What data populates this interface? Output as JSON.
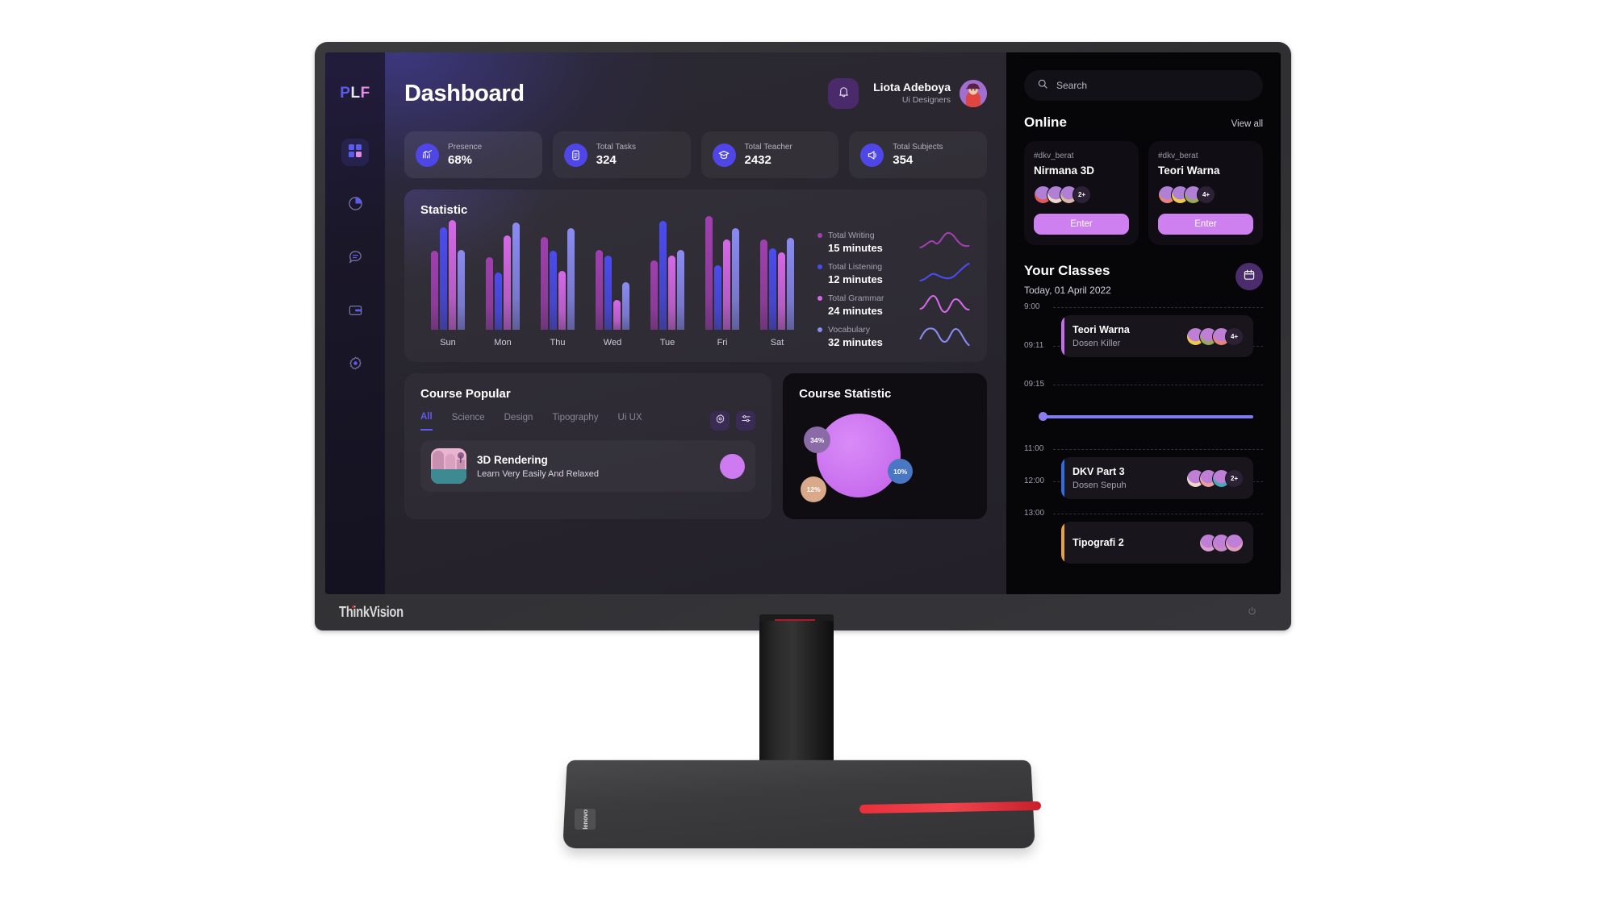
{
  "monitor": {
    "brand": "ThinkVision",
    "base_badge": "lenovo",
    "power_icon": "power-icon"
  },
  "rail": {
    "logo": {
      "p": "P",
      "l": "L",
      "f": "F"
    },
    "items": [
      {
        "name": "sidebar-item-dashboard",
        "icon": "grid-icon",
        "active": true
      },
      {
        "name": "sidebar-item-analytics",
        "icon": "pie-chart-icon",
        "active": false
      },
      {
        "name": "sidebar-item-messages",
        "icon": "chat-icon",
        "active": false
      },
      {
        "name": "sidebar-item-wallet",
        "icon": "wallet-icon",
        "active": false
      },
      {
        "name": "sidebar-item-settings",
        "icon": "gear-icon",
        "active": false
      }
    ]
  },
  "header": {
    "title": "Dashboard",
    "bell_icon": "bell-icon",
    "user": {
      "name": "Liota Adeboya",
      "role": "Ui Designers"
    }
  },
  "stats": [
    {
      "label": "Presence",
      "value": "68%",
      "icon": "trending-up-icon"
    },
    {
      "label": "Total Tasks",
      "value": "324",
      "icon": "document-icon"
    },
    {
      "label": "Total Teacher",
      "value": "2432",
      "icon": "graduation-cap-icon"
    },
    {
      "label": "Total Subjects",
      "value": "354",
      "icon": "megaphone-icon"
    }
  ],
  "statistic": {
    "title": "Statistic",
    "legend": [
      {
        "label": "Total Writing",
        "value": "15 minutes",
        "color": "#a13fb0"
      },
      {
        "label": "Total Listening",
        "value": "12 minutes",
        "color": "#4b4bf0"
      },
      {
        "label": "Total Grammar",
        "value": "24 minutes",
        "color": "#d668e8"
      },
      {
        "label": "Vocabulary",
        "value": "32 minutes",
        "color": "#8a8bf2"
      }
    ]
  },
  "chart_data": {
    "type": "bar",
    "title": "Statistic",
    "xlabel": "",
    "ylabel": "minutes",
    "grid": false,
    "legend_position": "right",
    "categories": [
      "Sun",
      "Mon",
      "Thu",
      "Wed",
      "Tue",
      "Fri",
      "Sat"
    ],
    "ylim": [
      0,
      100
    ],
    "series": [
      {
        "name": "Total Writing",
        "color": "#a13fb0",
        "values": [
          66,
          61,
          78,
          67,
          58,
          95,
          76
        ]
      },
      {
        "name": "Total Listening",
        "color": "#4b4bf0",
        "values": [
          86,
          48,
          66,
          62,
          91,
          54,
          68
        ]
      },
      {
        "name": "Total Grammar",
        "color": "#d668e8",
        "values": [
          92,
          79,
          49,
          25,
          62,
          76,
          65
        ]
      },
      {
        "name": "Vocabulary",
        "color": "#8a8bf2",
        "values": [
          67,
          90,
          85,
          40,
          67,
          85,
          77
        ]
      }
    ]
  },
  "course_popular": {
    "title": "Course Popular",
    "tabs": [
      {
        "label": "All",
        "active": true
      },
      {
        "label": "Science",
        "active": false
      },
      {
        "label": "Design",
        "active": false
      },
      {
        "label": "Tipography",
        "active": false
      },
      {
        "label": "Ui UX",
        "active": false
      }
    ],
    "actions": [
      {
        "name": "settings-button",
        "icon": "gear-icon"
      },
      {
        "name": "filter-button",
        "icon": "sliders-icon"
      }
    ],
    "items": [
      {
        "name": "3D Rendering",
        "subtitle": "Learn Very Easily And Relaxed",
        "thumb": "3d-render-thumbnail"
      }
    ]
  },
  "course_statistic": {
    "title": "Course Statistic",
    "bubbles": [
      {
        "value": "34%",
        "color": "#8a6ba8"
      },
      {
        "value": "10%",
        "color": "#4a77c2"
      },
      {
        "value": "12%",
        "color": "#d9a98a"
      }
    ]
  },
  "right_panel": {
    "search": {
      "placeholder": "Search",
      "icon": "search-icon",
      "value": ""
    },
    "online": {
      "title": "Online",
      "view_all": "View all",
      "cards": [
        {
          "tag": "#dkv_berat",
          "name": "Nirmana 3D",
          "more": "2+",
          "enter": "Enter",
          "avatars": [
            "#e05a52",
            "#f0d9c8",
            "#d8b8a0"
          ]
        },
        {
          "tag": "#dkv_berat",
          "name": "Teori Warna",
          "more": "4+",
          "enter": "Enter",
          "avatars": [
            "#e8857a",
            "#f2c94c",
            "#9aa858"
          ]
        }
      ]
    },
    "classes": {
      "title": "Your Classes",
      "date": "Today, 01 April 2022",
      "calendar_icon": "calendar-icon",
      "time_labels": [
        "9:00",
        "09:11",
        "09:15",
        "11:00",
        "12:00",
        "13:00"
      ],
      "events": [
        {
          "name": "Teori Warna",
          "teacher": "Dosen Killer",
          "more": "4+",
          "color": "#c66df0",
          "avatars": [
            "#f2c94c",
            "#9aa858",
            "#e8857a"
          ]
        },
        {
          "name": "DKV Part 3",
          "teacher": "Dosen Sepuh",
          "more": "2+",
          "color": "#2f6ee0",
          "avatars": [
            "#f0d8c8",
            "#e8a0a0",
            "#4aa8b8"
          ]
        },
        {
          "name": "Tipografi 2",
          "teacher": "",
          "more": "",
          "color": "#e8a33c",
          "avatars": [
            "#d9a0d0",
            "#c88ac0",
            "#e0a0b8"
          ]
        }
      ]
    }
  }
}
